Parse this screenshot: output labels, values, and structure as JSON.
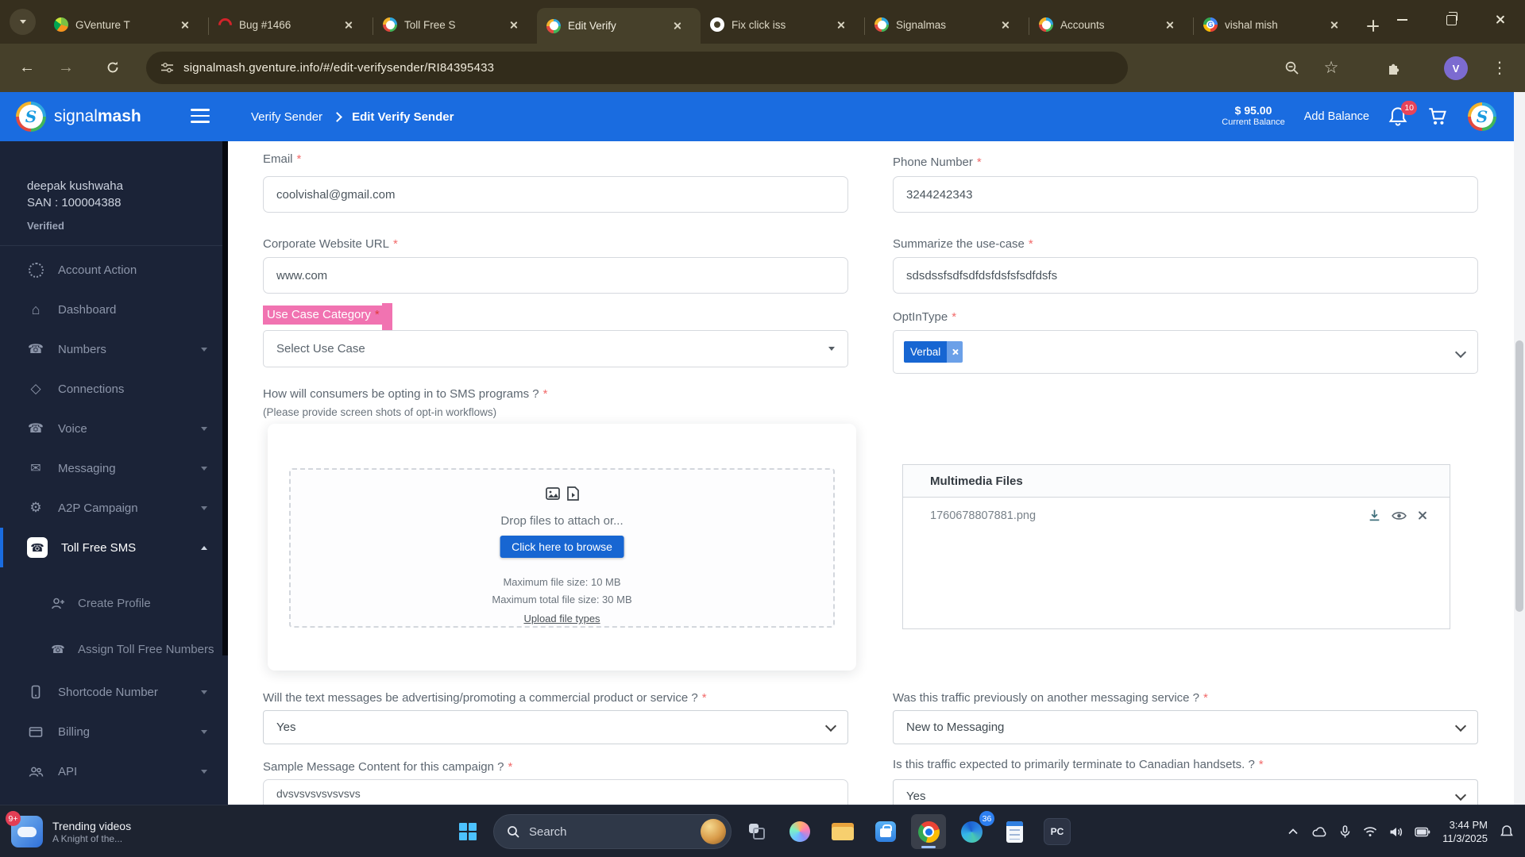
{
  "browser": {
    "tabs": [
      {
        "title": "GVenture T"
      },
      {
        "title": "Bug #1466"
      },
      {
        "title": "Toll Free S"
      },
      {
        "title": "Edit Verify"
      },
      {
        "title": "Fix click iss"
      },
      {
        "title": "Signalmas"
      },
      {
        "title": "Accounts"
      },
      {
        "title": "vishal mish"
      }
    ],
    "url": "signalmash.gventure.info/#/edit-verifysender/RI84395433",
    "avatar_letter": "V"
  },
  "glyphs": {
    "back": "←",
    "forward": "→",
    "star": "☆",
    "menu_dots": "⋮",
    "home": "⌂",
    "phone": "☎",
    "envelope": "✉",
    "gear": "⚙",
    "connections": "◇"
  },
  "header": {
    "brand_signal": "signal",
    "brand_mash": "mash",
    "breadcrumb_parent": "Verify Sender",
    "breadcrumb_current": "Edit Verify Sender",
    "balance_amount": "$ 95.00",
    "balance_label": "Current Balance",
    "add_balance_label": "Add Balance",
    "notification_count": "10"
  },
  "sidebar": {
    "user_name": "deepak kushwaha",
    "user_san": "SAN : 100004388",
    "user_status": "Verified",
    "items": [
      {
        "label": "Account Action"
      },
      {
        "label": "Dashboard"
      },
      {
        "label": "Numbers"
      },
      {
        "label": "Connections"
      },
      {
        "label": "Voice"
      },
      {
        "label": "Messaging"
      },
      {
        "label": "A2P Campaign"
      },
      {
        "label": "Toll Free SMS"
      },
      {
        "label": "Create Profile"
      },
      {
        "label": "Assign Toll Free Numbers"
      },
      {
        "label": "Shortcode Number"
      },
      {
        "label": "Billing"
      },
      {
        "label": "API"
      }
    ]
  },
  "form": {
    "required": "*",
    "email_label": "Email",
    "email_value": "coolvishal@gmail.com",
    "phone_label": "Phone Number",
    "phone_value": "3244242343",
    "website_label": "Corporate Website URL",
    "website_value": "www.com",
    "summary_label": "Summarize the use-case",
    "summary_value": "sdsdssfsdfsdfdsfdsfsfsdfdsfs",
    "usecase_label": "Use Case Category",
    "usecase_placeholder": "Select Use Case",
    "optin_label": "OptInType",
    "optin_tag": "Verbal",
    "optin_question": "How will consumers be opting in to SMS programs ?",
    "optin_hint": "(Please provide screen shots of opt-in workflows)",
    "advertising_question": "Will the text messages be advertising/promoting a commercial product or service ?",
    "advertising_value": "Yes",
    "previous_question": "Was this traffic previously on another messaging service ?",
    "previous_value": "New to Messaging",
    "sample_question": "Sample Message Content for this campaign ?",
    "sample_value": "dvsvsvsvsvsvsvs",
    "canadian_question": "Is this traffic expected to primarily terminate to Canadian handsets. ?",
    "canadian_value": "Yes"
  },
  "upload": {
    "drop_text": "Drop files to attach or...",
    "browse_label": "Click here to browse",
    "max_file": "Maximum file size: 10 MB",
    "max_total": "Maximum total file size: 30 MB",
    "types_link": "Upload file types"
  },
  "multimedia": {
    "title": "Multimedia Files",
    "file_name": "1760678807881.png"
  },
  "taskbar": {
    "widget_badge": "9+",
    "widget_title": "Trending videos",
    "widget_subtitle": "A Knight of the...",
    "search_placeholder": "Search",
    "browser_badge": "36",
    "pc_label": "PC",
    "time": "3:44 PM",
    "date": "11/3/2025"
  }
}
